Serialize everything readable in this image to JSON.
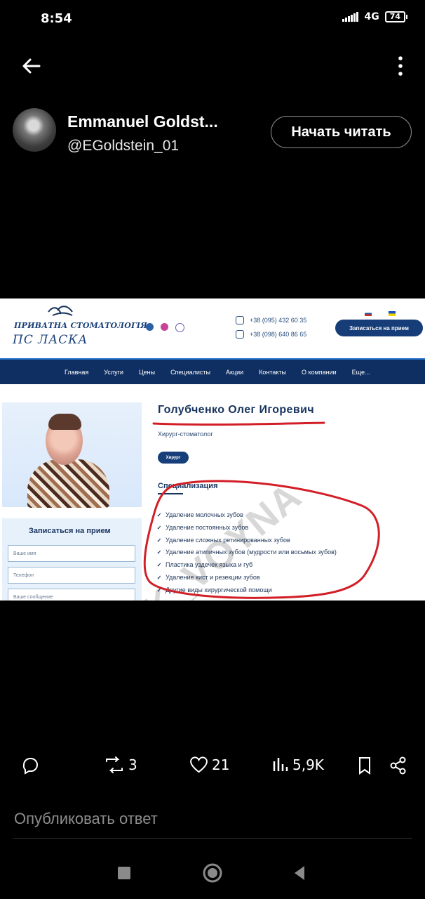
{
  "status_bar": {
    "time": "8:54",
    "network": "4G",
    "battery": "74"
  },
  "top_bar": {
    "back_icon": "arrow-left-icon",
    "more_icon": "more-vertical-icon"
  },
  "profile": {
    "name": "Emmanuel Goldst...",
    "handle": "@EGoldstein_01",
    "follow_label": "Начать читать"
  },
  "post_image": {
    "logo": {
      "line1": "ПРИВАТНА СТОМАТОЛОГІЯ",
      "line2": "ПС ЛАСКА"
    },
    "phones": [
      "+38 (095) 432 60 35",
      "+38 (098) 640 86 65"
    ],
    "appointment_button": "Записаться на прием",
    "menu": [
      "Главная",
      "Услуги",
      "Цены",
      "Специалисты",
      "Акции",
      "Контакты",
      "О компании",
      "Еще..."
    ],
    "doctor_name": "Голубченко Олег Игоревич",
    "role": "Хирург-стоматолог",
    "badge": "Хирург",
    "section_title": "Специализация",
    "specializations": [
      "Удаление молочных зубов",
      "Удаление постоянных зубов",
      "Удаление сложных ретинированных зубов",
      "Удаление атипичных зубов (мудрости или восьмых зубов)",
      "Пластика уздечек языка и губ",
      "Удаление кист и резекции зубов",
      "Другие виды хирургической помощи"
    ],
    "form": {
      "title": "Записаться на прием",
      "name_placeholder": "Ваше имя",
      "phone_placeholder": "Телефон",
      "message_placeholder": "Ваше сообщение"
    },
    "watermark": "@UK_VOYNA"
  },
  "actions": {
    "retweets": "3",
    "likes": "21",
    "views": "5,9K"
  },
  "reply": {
    "placeholder": "Опубликовать ответ"
  }
}
